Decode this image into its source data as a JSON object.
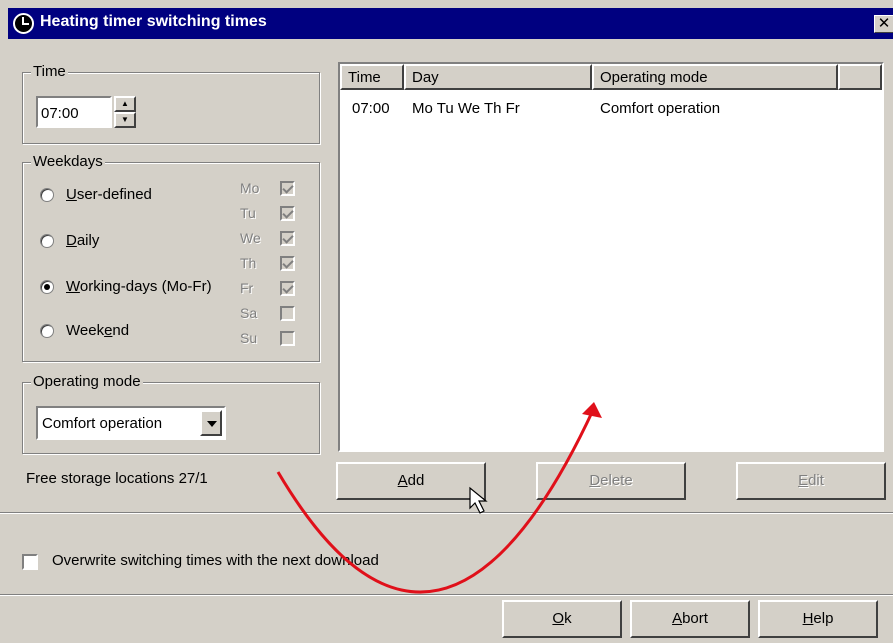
{
  "window": {
    "title": "Heating timer switching times",
    "close_label": "✕",
    "title_icon": "clock-icon"
  },
  "time_group": {
    "legend": "Time",
    "value": "07:00",
    "spin_up": "▲",
    "spin_down": "▼"
  },
  "weekdays_group": {
    "legend": "Weekdays",
    "options": [
      {
        "label_pre": "",
        "accel": "U",
        "label_post": "ser-defined",
        "checked": false
      },
      {
        "label_pre": "",
        "accel": "D",
        "label_post": "aily",
        "checked": false
      },
      {
        "label_pre": "",
        "accel": "W",
        "label_post": "orking-days (Mo-Fr)",
        "checked": true
      },
      {
        "label_pre": "Week",
        "accel": "e",
        "label_post": "nd",
        "checked": false
      }
    ],
    "days": [
      {
        "label": "Mo",
        "checked": true
      },
      {
        "label": "Tu",
        "checked": true
      },
      {
        "label": "We",
        "checked": true
      },
      {
        "label": "Th",
        "checked": true
      },
      {
        "label": "Fr",
        "checked": true
      },
      {
        "label": "Sa",
        "checked": false
      },
      {
        "label": "Su",
        "checked": false
      }
    ]
  },
  "operating_mode_group": {
    "legend": "Operating mode",
    "selected": "Comfort operation"
  },
  "storage": {
    "text": "Free storage locations 27/1"
  },
  "table": {
    "columns": [
      "Time",
      "Day",
      "Operating mode",
      ""
    ],
    "rows": [
      {
        "time": "07:00",
        "day": "Mo Tu We Th Fr",
        "mode": "Comfort operation"
      }
    ]
  },
  "actions": {
    "add": {
      "accel": "A",
      "rest": "dd",
      "enabled": true
    },
    "delete": {
      "accel": "D",
      "rest": "elete",
      "enabled": false
    },
    "edit": {
      "accel": "E",
      "rest": "dit",
      "enabled": false
    }
  },
  "overwrite": {
    "label": "Overwrite switching times with the next download",
    "checked": false
  },
  "footer": {
    "ok": {
      "accel": "O",
      "rest": "k"
    },
    "abort": {
      "accel": "A",
      "rest": "bort"
    },
    "help": {
      "accel": "H",
      "rest": "elp"
    }
  },
  "colors": {
    "titlebar": "#000080",
    "face": "#d4d0c8",
    "annotation_arrow": "#e0101a"
  }
}
